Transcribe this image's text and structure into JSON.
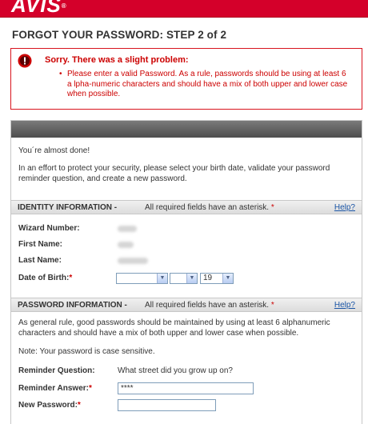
{
  "brand": {
    "logo_text": "AVIS",
    "logo_mark": "®",
    "color": "#d4002a"
  },
  "page_title": "FORGOT YOUR PASSWORD: STEP 2 of 2",
  "error": {
    "heading": "Sorry. There was a slight problem:",
    "items": [
      "Please enter a valid Password. As a rule, passwords should be using at least 6 a lpha-numeric characters and should have a mix of both upper and lower case when possible."
    ],
    "color": "#cc0000",
    "icon": "error-icon"
  },
  "intro": {
    "line1": "You´re almost done!",
    "line2": "In an effort to protect your security, please select your birth date, validate your password reminder question, and create a new password."
  },
  "identity": {
    "title": "IDENTITY INFORMATION -",
    "required_note": "All required fields have an asterisk.",
    "required_star": "*",
    "help": "Help?",
    "labels": {
      "wizard_number": "Wizard Number:",
      "first_name": "First Name:",
      "last_name": "Last Name:",
      "dob": "Date of Birth:",
      "dob_star": "*"
    },
    "dob": {
      "month": "",
      "day": "",
      "year": "19"
    }
  },
  "password": {
    "title": "PASSWORD INFORMATION -",
    "required_note": "All required fields have an asterisk.",
    "required_star": "*",
    "help": "Help?",
    "rule_text": "As general rule, good passwords should be maintained by using at least 6 alphanumeric characters and should have a mix of both upper and lower case when possible.",
    "note": "Note: Your password is case sensitive.",
    "labels": {
      "reminder_question": "Reminder Question:",
      "reminder_answer": "Reminder Answer:",
      "reminder_answer_star": "*",
      "new_password": "New Password:",
      "new_password_star": "*"
    },
    "reminder_question_value": "What street did you grow up on?",
    "reminder_answer_value": "****",
    "new_password_value": ""
  }
}
